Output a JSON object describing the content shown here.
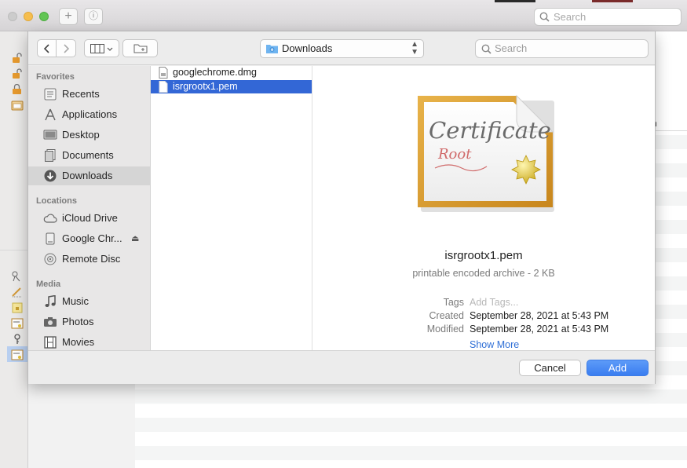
{
  "background_app": {
    "search_placeholder": "Search",
    "column_header_fragment": "n"
  },
  "toolbar": {
    "location": "Downloads",
    "search_placeholder": "Search"
  },
  "sidebar": {
    "favorites_heading": "Favorites",
    "favorites": [
      {
        "label": "Recents",
        "icon": "clock-icon"
      },
      {
        "label": "Applications",
        "icon": "applications-icon"
      },
      {
        "label": "Desktop",
        "icon": "desktop-icon"
      },
      {
        "label": "Documents",
        "icon": "document-icon"
      },
      {
        "label": "Downloads",
        "icon": "download-icon",
        "selected": true
      }
    ],
    "locations_heading": "Locations",
    "locations": [
      {
        "label": "iCloud Drive",
        "icon": "cloud-icon"
      },
      {
        "label": "Google Chr...",
        "icon": "disk-image-icon",
        "eject": true
      },
      {
        "label": "Remote Disc",
        "icon": "disc-icon"
      }
    ],
    "media_heading": "Media",
    "media": [
      {
        "label": "Music",
        "icon": "music-note-icon"
      },
      {
        "label": "Photos",
        "icon": "camera-icon"
      },
      {
        "label": "Movies",
        "icon": "film-icon"
      }
    ]
  },
  "files": [
    {
      "name": "googlechrome.dmg",
      "selected": false
    },
    {
      "name": "isrgrootx1.pem",
      "selected": true
    }
  ],
  "preview": {
    "icon_text_main": "Certificate",
    "icon_text_sub": "Root",
    "file_name": "isrgrootx1.pem",
    "kind": "printable encoded archive - 2 KB",
    "tags_label": "Tags",
    "tags_placeholder": "Add Tags...",
    "created_label": "Created",
    "created_value": "September 28, 2021 at 5:43 PM",
    "modified_label": "Modified",
    "modified_value": "September 28, 2021 at 5:43 PM",
    "show_more": "Show More"
  },
  "footer": {
    "cancel_label": "Cancel",
    "add_label": "Add"
  },
  "colors": {
    "selection_blue": "#3367d6",
    "primary_button": "#3a7df0",
    "link_blue": "#2f6fd6"
  }
}
